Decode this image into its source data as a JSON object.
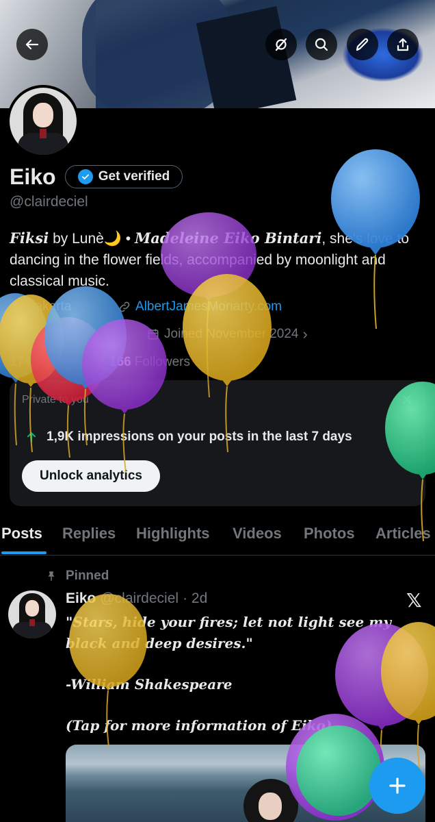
{
  "header": {
    "back_icon": "arrow-left-icon",
    "actions": [
      "grok-icon",
      "search-icon",
      "edit-icon",
      "share-icon"
    ]
  },
  "profile": {
    "name": "Eiko",
    "get_verified_label": "Get verified",
    "handle": "@clairdeciel",
    "bio": {
      "part1_italic": "Fiksi",
      "part2": " by Lunè🌙 • ",
      "part3_italic": "Madeleine Eiko Bintari",
      "part4": ", she's love to dancing in the flower fields, accompanied by moonlight and classical music."
    },
    "location": "Jakarta",
    "website": "AlbertJamesMoriarty.com",
    "joined": "Joined November 2024",
    "following_count": "174",
    "following_label": "Following",
    "followers_count": "166",
    "followers_label": "Followers"
  },
  "analytics": {
    "private_label": "Private to you",
    "impressions_text": "1,9K impressions on your posts in the last 7 days",
    "unlock_label": "Unlock analytics"
  },
  "tabs": [
    "Posts",
    "Replies",
    "Highlights",
    "Videos",
    "Photos",
    "Articles"
  ],
  "post": {
    "pinned_label": "Pinned",
    "author_name": "Eiko",
    "author_handle": "@clairdeciel",
    "time": "· 2d",
    "line1": "\"Stars, hide your fires; let not light see my",
    "line2": "black and deep desires.\"",
    "line3": "-William Shakespeare",
    "line4": "(Tap for more information of Eiko)"
  },
  "fab_icon": "plus-icon",
  "colors": {
    "accent": "#1d9bf0",
    "background": "#000000",
    "muted": "#71767b"
  }
}
